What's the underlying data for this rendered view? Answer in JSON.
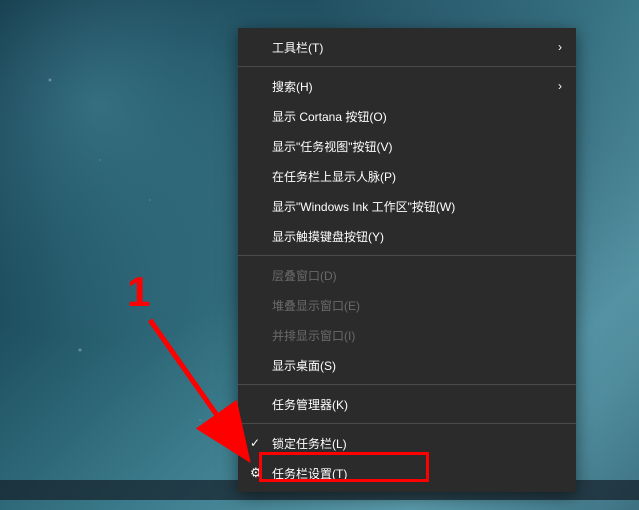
{
  "menu": {
    "toolbars": "工具栏(T)",
    "search": "搜索(H)",
    "show_cortana": "显示 Cortana 按钮(O)",
    "show_taskview": "显示\"任务视图\"按钮(V)",
    "show_people": "在任务栏上显示人脉(P)",
    "show_ink": "显示\"Windows Ink 工作区\"按钮(W)",
    "show_touch_keyboard": "显示触摸键盘按钮(Y)",
    "cascade": "层叠窗口(D)",
    "stacked": "堆叠显示窗口(E)",
    "side_by_side": "并排显示窗口(I)",
    "show_desktop": "显示桌面(S)",
    "task_manager": "任务管理器(K)",
    "lock_taskbar": "锁定任务栏(L)",
    "taskbar_settings": "任务栏设置(T)"
  },
  "annotation": {
    "number": "1"
  },
  "icons": {
    "chevron": "›",
    "check": "✓",
    "gear": "⚙"
  }
}
